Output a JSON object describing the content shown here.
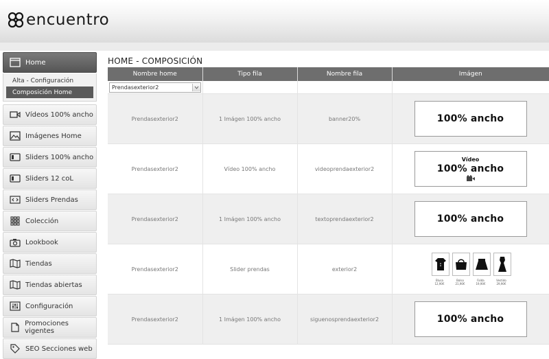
{
  "brand": {
    "name": "encuentro"
  },
  "sidebar": {
    "items": [
      {
        "label": "Home",
        "icon": "window-icon",
        "active": true,
        "subitems": [
          {
            "label": "Alta - Configuración",
            "active": false
          },
          {
            "label": "Composición Home",
            "active": true
          }
        ]
      },
      {
        "label": "Vídeos 100% ancho",
        "icon": "video-camera-icon"
      },
      {
        "label": "Imágenes Home",
        "icon": "image-icon"
      },
      {
        "label": "Sliders 100% ancho",
        "icon": "slider-icon"
      },
      {
        "label": "Sliders 12 coL",
        "icon": "slider-icon"
      },
      {
        "label": "Sliders Prendas",
        "icon": "code-brackets-icon"
      },
      {
        "label": "Colección",
        "icon": "grid-icon"
      },
      {
        "label": "Lookbook",
        "icon": "camera-icon"
      },
      {
        "label": "Tiendas",
        "icon": "map-icon"
      },
      {
        "label": "Tiendas abiertas",
        "icon": "map-icon"
      },
      {
        "label": "Configuración",
        "icon": "sliders-settings-icon"
      },
      {
        "label": "Promociones vigentes",
        "icon": "document-icon"
      },
      {
        "label": "SEO Secciones web",
        "icon": "tag-icon"
      }
    ]
  },
  "main": {
    "title": "HOME - COMPOSICIÓN",
    "columns": [
      "Nombre home",
      "Tipo fila",
      "Nombre fila",
      "Imágen"
    ],
    "filter": {
      "selected": "Prendasexterior2"
    },
    "rows": [
      {
        "home": "Prendasexterior2",
        "tipo": "1 Imágen 100% ancho",
        "nombre": "banner20%",
        "thumb": {
          "kind": "text",
          "small": "",
          "big": "100% ancho"
        }
      },
      {
        "home": "Prendasexterior2",
        "tipo": "Vídeo 100% ancho",
        "nombre": "videoprendaexterior2",
        "thumb": {
          "kind": "video",
          "small": "Vídeo",
          "big": "100% ancho"
        }
      },
      {
        "home": "Prendasexterior2",
        "tipo": "1 Imágen 100% ancho",
        "nombre": "textoprendaexterior2",
        "thumb": {
          "kind": "text",
          "small": "",
          "big": "100% ancho"
        }
      },
      {
        "home": "Prendasexterior2",
        "tipo": "Slider prendas",
        "nombre": "exterior2",
        "thumb": {
          "kind": "slider",
          "cards": [
            {
              "label": "Blusa",
              "sub": "12,90€"
            },
            {
              "label": "Bolso",
              "sub": "21,90€"
            },
            {
              "label": "Falda",
              "sub": "19,90€"
            },
            {
              "label": "Vestido",
              "sub": "29,90€"
            }
          ]
        }
      },
      {
        "home": "Prendasexterior2",
        "tipo": "1 Imágen 100% ancho",
        "nombre": "siguenosprendaexterior2",
        "thumb": {
          "kind": "text",
          "small": "",
          "big": "100% ancho"
        }
      }
    ]
  }
}
